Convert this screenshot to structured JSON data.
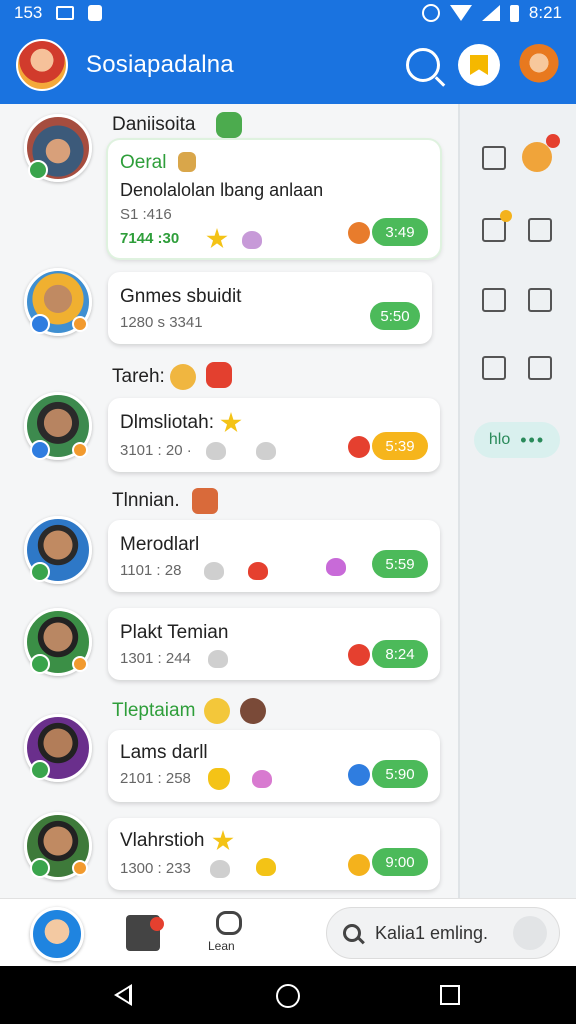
{
  "status": {
    "time_left": "153",
    "clock": "8:21"
  },
  "app": {
    "title": "Sosiapadalna",
    "search_icon": "search-icon",
    "bookmark_icon": "bookmark-icon"
  },
  "feed": {
    "section_1": {
      "label": "Daniisoita"
    },
    "item_1": {
      "title": "Oeral",
      "body": "Denolalolan lbang anlaan",
      "meta": "S1 :416",
      "stats": "7144 :30",
      "time": "3:49"
    },
    "item_2": {
      "name": "Gnmes sbuidit",
      "meta": "1280 s 3341",
      "time": "5:50"
    },
    "section_2": {
      "label": "Tareh:"
    },
    "item_3": {
      "name": "Dlmsliotah:",
      "meta": "3101 : 20 ·",
      "time": "5:39"
    },
    "section_3": {
      "label": "Tlnnian."
    },
    "item_4": {
      "name": "Merodlarl",
      "meta": "1101 : 28",
      "time": "5:59"
    },
    "item_5": {
      "name": "Plakt Temian",
      "meta": "1301 : 244",
      "time": "8:24"
    },
    "section_4": {
      "label": "Tleptaiam"
    },
    "item_6": {
      "name": "Lams darll",
      "meta": "2101 : 258",
      "time": "5:90"
    },
    "item_7": {
      "name": "Vlahrstioh",
      "meta": "1300 : 233",
      "time": "9:00"
    }
  },
  "rail": {
    "chip_label": "hlo"
  },
  "bottom_nav": {
    "chat_label": "Lean",
    "search_placeholder": "Kalia1 emling."
  },
  "colors": {
    "primary": "#1a73e0",
    "accent_green": "#4cba5a",
    "accent_yellow": "#f6b51c"
  }
}
